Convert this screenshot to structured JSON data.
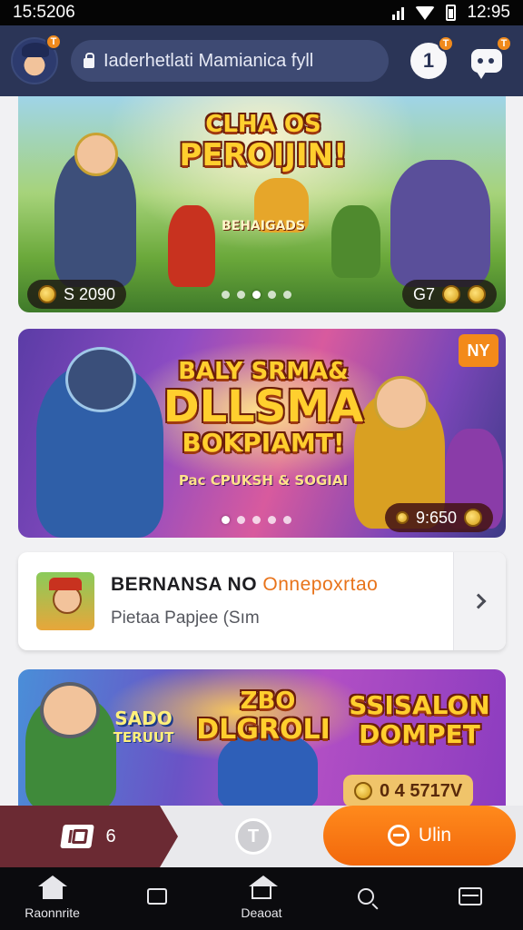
{
  "status_bar": {
    "time": "15:5206",
    "clock": "12:95"
  },
  "header": {
    "avatar_badge": "T",
    "search_text": "Iaderhetlati Mamianica fyll",
    "notification_label": "1",
    "notification_badge": "T",
    "chat_badge": "T"
  },
  "banners": [
    {
      "title_line1": "CLHA OS",
      "title_line2": "PEROIJIN!",
      "subtitle": "BEHAIGADS",
      "coins": "S 2090",
      "counter": "G7",
      "dots": 5,
      "active_dot": 2
    },
    {
      "badge": "NY",
      "title_line1": "BALY SRMA&",
      "title_line2": "DLLSMA",
      "title_line3": "BOKPIAMT!",
      "subtitle": "Pac CPUKSH & SOGIAI",
      "coins": "9:650",
      "dots": 5,
      "active_dot": 1
    },
    {
      "left_text_1": "SADO",
      "left_text_2": "TERUUT",
      "center_text_1": "ZBO",
      "center_text_2": "DLGROLI",
      "right_text_1": "SSISALON",
      "right_text_2": "DOMPET",
      "coins": "0 4 5717V"
    }
  ],
  "list_card": {
    "title": "BERNANSA NO",
    "title_accent": "Onnepoxrtao",
    "subtitle": "Pietaa Papjee (Sım"
  },
  "action_bar": {
    "left_count": "6",
    "mid_label": "T",
    "right_label": "Ulin"
  },
  "bottom_nav": [
    {
      "label": "Raonnrite",
      "icon": "home-icon"
    },
    {
      "label": "",
      "icon": "square-icon"
    },
    {
      "label": "Deaoat",
      "icon": "home-outline-icon"
    },
    {
      "label": "",
      "icon": "search-icon"
    },
    {
      "label": "",
      "icon": "menu-icon"
    }
  ],
  "colors": {
    "header_bg": "#2b3557",
    "accent_orange": "#f38a1a",
    "maroon": "#6b2a33"
  }
}
